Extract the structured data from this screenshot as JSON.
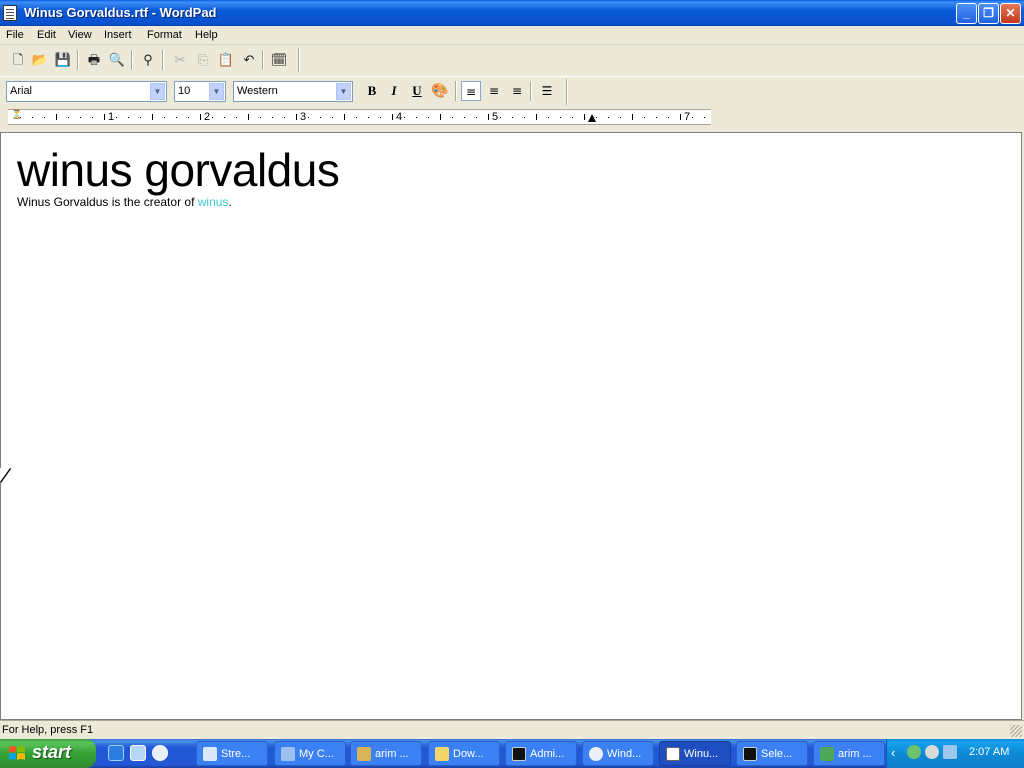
{
  "window": {
    "title": "Winus Gorvaldus.rtf - WordPad",
    "controls": {
      "minimize": "_",
      "restore": "❐",
      "close": "✕"
    }
  },
  "menu": [
    "File",
    "Edit",
    "View",
    "Insert",
    "Format",
    "Help"
  ],
  "toolbar": {
    "buttons": [
      "new-icon",
      "open-icon",
      "save-icon",
      "print-icon",
      "print-preview-icon",
      "find-icon",
      "cut-icon",
      "copy-icon",
      "paste-icon",
      "undo-icon",
      "insert-datetime-icon"
    ]
  },
  "format_bar": {
    "font": "Arial",
    "size": "10",
    "script": "Western",
    "bold": "B",
    "italic": "I",
    "underline": "U",
    "alignment": "left"
  },
  "ruler": {
    "numbers": [
      "1",
      "2",
      "3",
      "4",
      "5",
      "7"
    ]
  },
  "document": {
    "heading": "winus gorvaldus",
    "body_prefix": "Winus Gorvaldus is the creator of ",
    "body_link": "winus",
    "body_suffix": ".",
    "link_color": "#3ec8d8"
  },
  "status": {
    "text": "For Help, press F1"
  },
  "taskbar": {
    "start": "start",
    "tasks": [
      {
        "label": "Stre..."
      },
      {
        "label": "My C..."
      },
      {
        "label": "arim ..."
      },
      {
        "label": "Dow..."
      },
      {
        "label": "Admi..."
      },
      {
        "label": "Wind..."
      },
      {
        "label": "Winu...",
        "active": true
      },
      {
        "label": "Sele..."
      },
      {
        "label": "arim ..."
      }
    ],
    "clock": "2:07 AM"
  }
}
